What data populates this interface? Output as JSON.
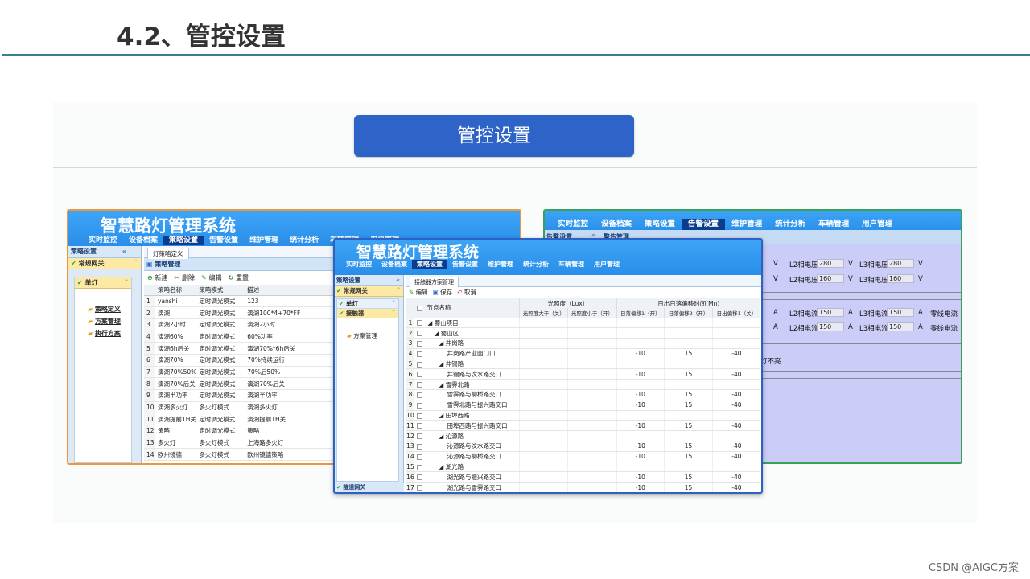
{
  "slide": {
    "title": "4.2、管控设置",
    "section_button": "管控设置",
    "footer": "CSDN @AIGC方案"
  },
  "system_title": "智慧路灯管理系统",
  "nav": [
    "实时监控",
    "设备档案",
    "策略设置",
    "告警设置",
    "维护管理",
    "统计分析",
    "车辆管理",
    "用户管理"
  ],
  "left_window": {
    "active_nav": 2,
    "sidebar_title": "策略设置",
    "sidebar_group": "常规网关",
    "sidebar_sub": "单灯",
    "sidebar_links": [
      "策略定义",
      "方案管理",
      "执行方案"
    ],
    "tab": "灯策略定义",
    "panel_title": "策略管理",
    "toolbar": [
      "新建",
      "删除",
      "编辑",
      "重置"
    ],
    "columns": [
      "",
      "策略名称",
      "策略模式",
      "描述"
    ],
    "rows": [
      [
        "1",
        "yanshi",
        "定时调光模式",
        "123"
      ],
      [
        "2",
        "演湖",
        "定时调光模式",
        "演湖100*4+70*FF"
      ],
      [
        "3",
        "演湖2小时",
        "定时调光模式",
        "演湖2小时"
      ],
      [
        "4",
        "演湖60%",
        "定时调光模式",
        "60%功率"
      ],
      [
        "5",
        "演湖6h后关",
        "定时调光模式",
        "演湖70%*6h后关"
      ],
      [
        "6",
        "演湖70%",
        "定时调光模式",
        "70%持续运行"
      ],
      [
        "7",
        "演湖70%50%",
        "定时调光模式",
        "70%后50%"
      ],
      [
        "8",
        "演湖70%后关",
        "定时调光模式",
        "演湖70%后关"
      ],
      [
        "9",
        "演湖半功率",
        "定时调光模式",
        "演湖半功率"
      ],
      [
        "10",
        "演湖多火灯",
        "多火灯模式",
        "演湖多火灯"
      ],
      [
        "11",
        "演湖提前1H关",
        "定时调光模式",
        "演湖提前1H关"
      ],
      [
        "12",
        "策略",
        "定时调光模式",
        "策略"
      ],
      [
        "13",
        "多火灯",
        "多火灯模式",
        "上海路多火灯"
      ],
      [
        "14",
        "欧州镜德",
        "多火灯模式",
        "欧州镜德策略"
      ]
    ]
  },
  "middle_window": {
    "active_nav": 2,
    "sidebar_title": "策略设置",
    "sidebar_group": "常规网关",
    "sidebar_sub1": "单灯",
    "sidebar_sub2": "接触器",
    "sidebar_link": "方案管理",
    "sidebar_bottom": "隧道网关",
    "tab": "接触器方案管理",
    "toolbar": [
      "编辑",
      "保存",
      "取消"
    ],
    "header_group1": "光照度（Lux）",
    "header_group2": "日出日落偏移时间(Mn)",
    "columns": [
      "节点名称",
      "光照度大于（关）",
      "光照度小于（开）",
      "日落偏移1（开）",
      "日落偏移2（开）",
      "日出偏移1（关）"
    ],
    "rows": [
      [
        "1",
        "1",
        "◢ 蜀山项目",
        "",
        "",
        "",
        "",
        ""
      ],
      [
        "2",
        "2",
        "◢ 蜀山区",
        "",
        "",
        "",
        "",
        ""
      ],
      [
        "3",
        "3",
        "◢ 井岗路",
        "",
        "",
        "",
        "",
        ""
      ],
      [
        "4",
        "4",
        "井岗路产业园门口",
        "",
        "",
        "-10",
        "15",
        "-40"
      ],
      [
        "5",
        "5",
        "◢ 井锡路",
        "",
        "",
        "",
        "",
        ""
      ],
      [
        "6",
        "6",
        "井锡路与汶水路交口",
        "",
        "",
        "-10",
        "15",
        "-40"
      ],
      [
        "7",
        "7",
        "◢ 雪霁北路",
        "",
        "",
        "",
        "",
        ""
      ],
      [
        "8",
        "8",
        "雪霁路与柳桥路交口",
        "",
        "",
        "-10",
        "15",
        "-40"
      ],
      [
        "9",
        "9",
        "雪霁北路与振兴路交口",
        "",
        "",
        "-10",
        "15",
        "-40"
      ],
      [
        "10",
        "10",
        "◢ 田埠西路",
        "",
        "",
        "",
        "",
        ""
      ],
      [
        "11",
        "11",
        "田埠西路与振兴路交口",
        "",
        "",
        "-10",
        "15",
        "-40"
      ],
      [
        "12",
        "12",
        "◢ 沁源路",
        "",
        "",
        "",
        "",
        ""
      ],
      [
        "13",
        "13",
        "沁源路与汶水路交口",
        "",
        "",
        "-10",
        "15",
        "-40"
      ],
      [
        "14",
        "14",
        "沁源路与柳桥路交口",
        "",
        "",
        "-10",
        "15",
        "-40"
      ],
      [
        "15",
        "15",
        "◢ 湖光路",
        "",
        "",
        "",
        "",
        ""
      ],
      [
        "16",
        "16",
        "湖光路与振兴路交口",
        "",
        "",
        "-10",
        "15",
        "-40"
      ],
      [
        "17",
        "17",
        "湖光路与雪霁路交口",
        "",
        "",
        "-10",
        "15",
        "-40"
      ]
    ]
  },
  "right_window": {
    "active_nav": 3,
    "sidebar_title": "告警设置",
    "panel_title": "警告管理",
    "voltage": [
      {
        "v_unit": "V",
        "l2_label": "L2相电压",
        "l2": "280",
        "l2_unit": "V",
        "l3_label": "L3相电压",
        "l3": "280",
        "l3_unit": "V"
      },
      {
        "v_unit": "V",
        "l2_label": "L2相电压",
        "l2": "160",
        "l2_unit": "V",
        "l3_label": "L3相电压",
        "l3": "160",
        "l3_unit": "V"
      }
    ],
    "current": [
      {
        "a_unit": "A",
        "l2_label": "L2相电流",
        "l2": "150",
        "l2_unit": "A",
        "l3_label": "L3相电流",
        "l3": "150",
        "l3_unit": "A",
        "n_label": "零线电流"
      },
      {
        "a_unit": "A",
        "l2_label": "L2相电流",
        "l2": "150",
        "l2_unit": "A",
        "l3_label": "L3相电流",
        "l3": "150",
        "l3_unit": "A",
        "n_label": "零线电流"
      }
    ],
    "note": "灯不亮"
  }
}
